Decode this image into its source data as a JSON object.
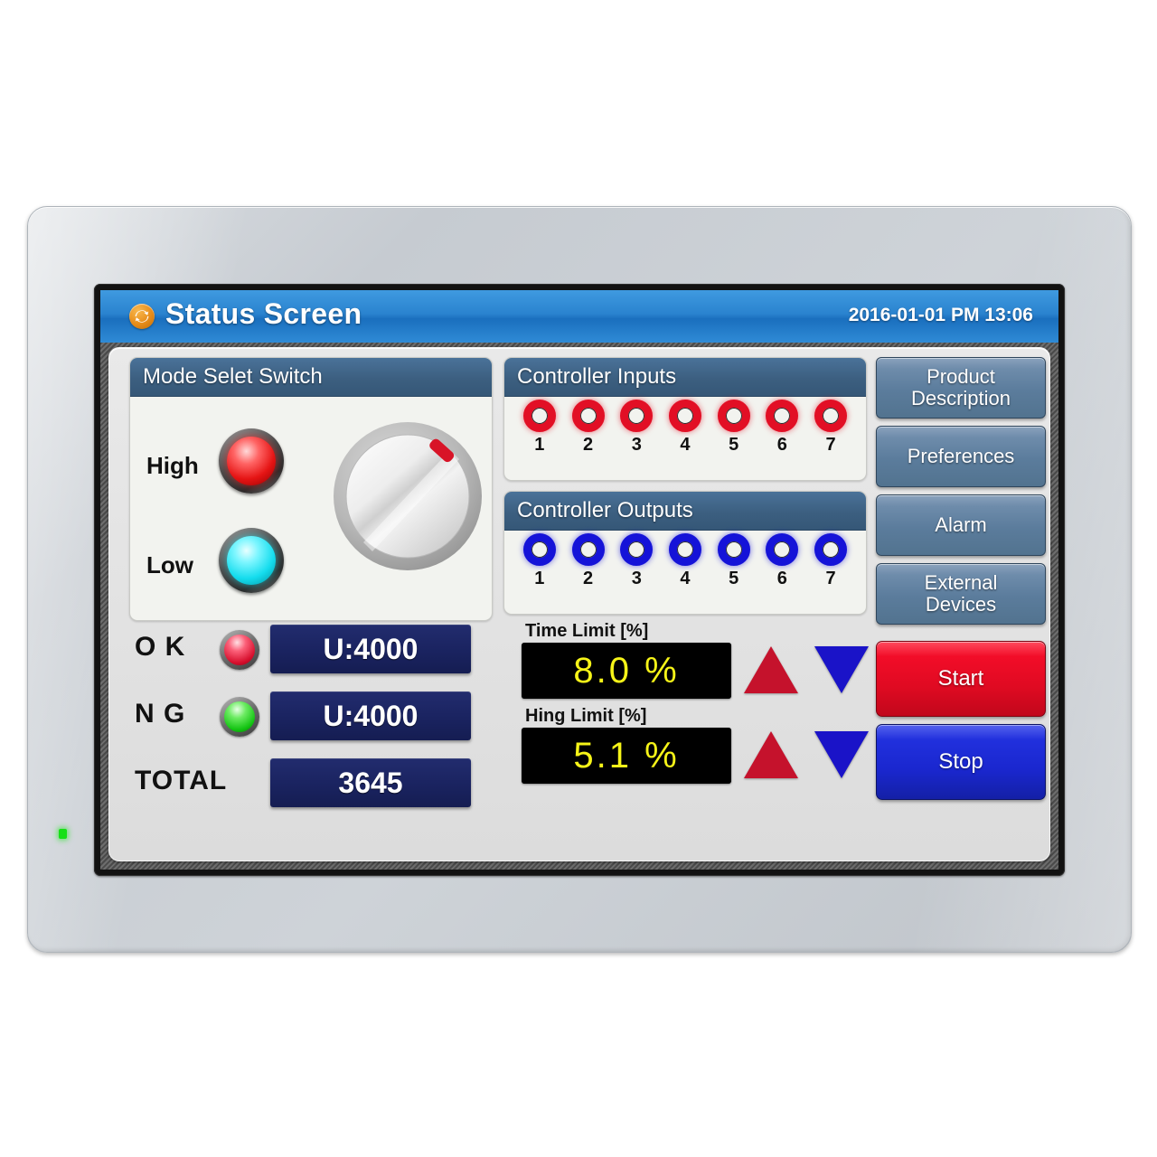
{
  "header": {
    "icon": "refresh-icon",
    "title": "Status Screen",
    "datetime": "2016-01-01 PM 13:06"
  },
  "mode_panel": {
    "title": "Mode Selet Switch",
    "lamps": [
      {
        "label": "High",
        "color": "#e51414",
        "state": "on"
      },
      {
        "label": "Low",
        "color": "#14dced",
        "state": "on"
      }
    ],
    "knob": {
      "name": "mode-rotary-knob",
      "indicator_color": "#d81427",
      "angle_deg": 45
    }
  },
  "controller_inputs": {
    "title": "Controller Inputs",
    "color": "#e20f25",
    "leds": [
      "1",
      "2",
      "3",
      "4",
      "5",
      "6",
      "7"
    ]
  },
  "controller_outputs": {
    "title": "Controller Outputs",
    "color": "#1513d8",
    "leds": [
      "1",
      "2",
      "3",
      "4",
      "5",
      "6",
      "7"
    ]
  },
  "counters": [
    {
      "label": "O K",
      "lamp": "red",
      "value": "U:4000"
    },
    {
      "label": "N G",
      "lamp": "green",
      "value": "U:4000"
    },
    {
      "label": "TOTAL",
      "lamp": "none",
      "value": "3645"
    }
  ],
  "limits": [
    {
      "label": "Time Limit [%]",
      "value": "8.0 %",
      "up": "increase",
      "down": "decrease"
    },
    {
      "label": "Hing Limit [%]",
      "value": "5.1 %",
      "up": "increase",
      "down": "decrease"
    }
  ],
  "nav_buttons": [
    {
      "label": "Product\nDescription"
    },
    {
      "label": "Preferences"
    },
    {
      "label": "Alarm"
    },
    {
      "label": "External\nDevices"
    }
  ],
  "action_buttons": {
    "start": "Start",
    "stop": "Stop"
  },
  "device": {
    "power_led_color": "#16e016"
  },
  "colors": {
    "titlebar_blue": "#2a83cf",
    "panel_header": "#3c5f80",
    "value_navy": "#1a2360",
    "lcd_yellow": "#f6f418",
    "start_red": "#e00a22",
    "stop_blue": "#1a27cf"
  }
}
